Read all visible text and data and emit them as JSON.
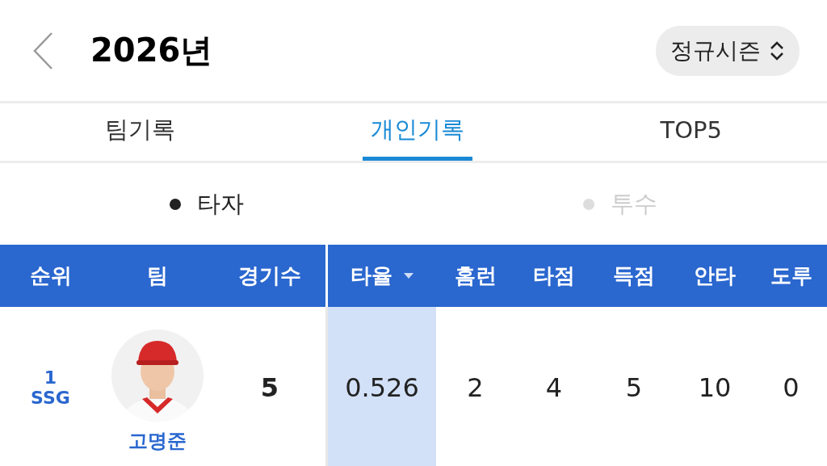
{
  "header": {
    "title": "2026년",
    "season": "정규시즌"
  },
  "tabs": [
    {
      "label": "팀기록",
      "selected": false
    },
    {
      "label": "개인기록",
      "selected": true
    },
    {
      "label": "TOP5",
      "selected": false
    }
  ],
  "sub_tabs": [
    {
      "label": "타자",
      "selected": true
    },
    {
      "label": "투수",
      "selected": false
    }
  ],
  "table": {
    "columns": [
      {
        "label": "순위",
        "sorted": false
      },
      {
        "label": "팀",
        "sorted": false
      },
      {
        "label": "경기수",
        "sorted": false
      },
      {
        "label": "타율",
        "sorted": true
      },
      {
        "label": "홈런",
        "sorted": false
      },
      {
        "label": "타점",
        "sorted": false
      },
      {
        "label": "득점",
        "sorted": false
      },
      {
        "label": "안타",
        "sorted": false
      },
      {
        "label": "도루",
        "sorted": false
      }
    ],
    "rows": [
      {
        "rank": "1",
        "team": "SSG",
        "player": "고명준",
        "games": "5",
        "stats": [
          "0.526",
          "2",
          "4",
          "5",
          "10",
          "0"
        ]
      }
    ]
  }
}
